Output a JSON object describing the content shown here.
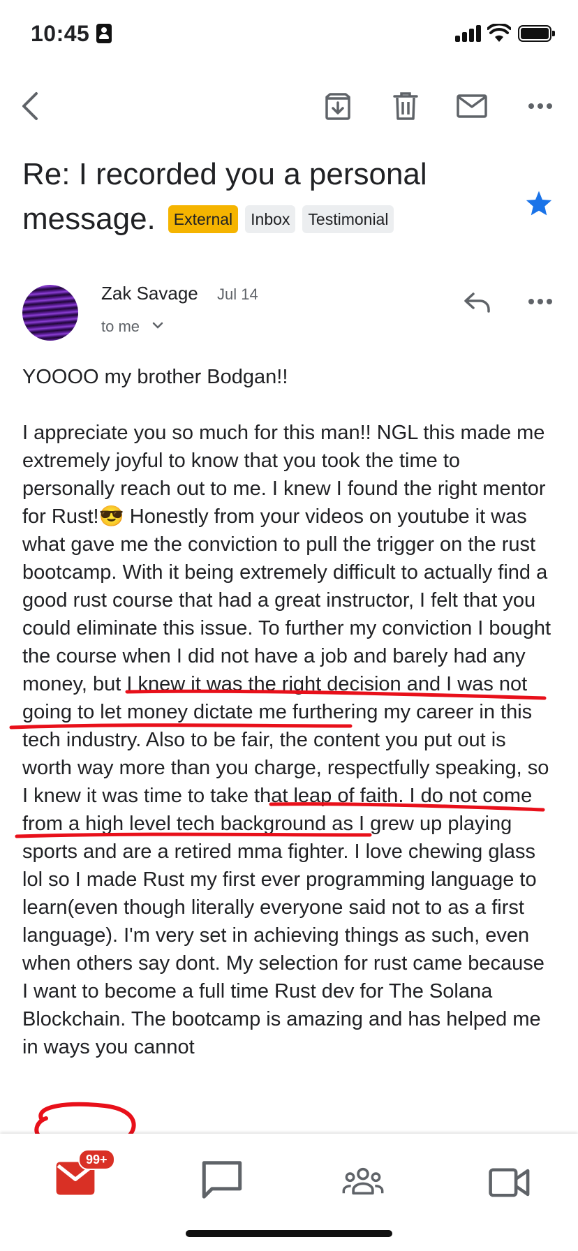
{
  "status_bar": {
    "time": "10:45"
  },
  "toolbar": {
    "back_icon": "arrow-back-icon",
    "archive_icon": "archive-icon",
    "delete_icon": "trash-icon",
    "mark_unread_icon": "mail-icon",
    "more_icon": "more-horizontal-icon"
  },
  "email": {
    "subject_line1": "Re: I recorded you a personal",
    "subject_line2": "message.",
    "labels": [
      "External",
      "Inbox",
      "Testimonial"
    ],
    "starred": true,
    "sender": "Zak Savage",
    "date": "Jul 14",
    "recipient": "to me",
    "greeting": "YOOOO my brother Bodgan!!",
    "body_parts": [
      " I appreciate you so much for this man!! NGL this made me extremely joyful to know that you took the time to personally reach out to me. I knew I found the right mentor for Rust!",
      "😎",
      " Honestly from your videos on youtube it was what gave me the conviction to pull the trigger on the rust bootcamp. With it being extremely difficult to actually find a good rust course that had a great instructor, I felt that you could eliminate this issue. To further my conviction",
      " I bought the course when I did not have a job and barely had any money",
      ", but I knew it was the right decision and I was not going to let money dictate me furthering my career in this tech industry. Also to be fair, ",
      "the content you put out is worth way more than you charge",
      ", respectfully speaking, so I knew it was time to take that leap of faith. I do not come from a high level tech background as I grew up playing sports and are a retired mma fighter. I love chewing glass lol so I made Rust my first ever programming language to learn(even though literally everyone said not to as a first language). I'm very set in achieving things as such, even when others say dont. My selection for rust came because I want to become a full time Rust dev for The Solana Blockchain. The bootcamp is amazing and has helped me in ways you cannot"
    ]
  },
  "bottom_nav": {
    "mail_badge": "99+",
    "items": [
      "mail-icon",
      "chat-icon",
      "spaces-icon",
      "meet-icon"
    ]
  },
  "colors": {
    "label_external": "#f5b400",
    "star": "#1a73e8",
    "annotation": "#e8101a",
    "mail_active": "#d93025"
  }
}
